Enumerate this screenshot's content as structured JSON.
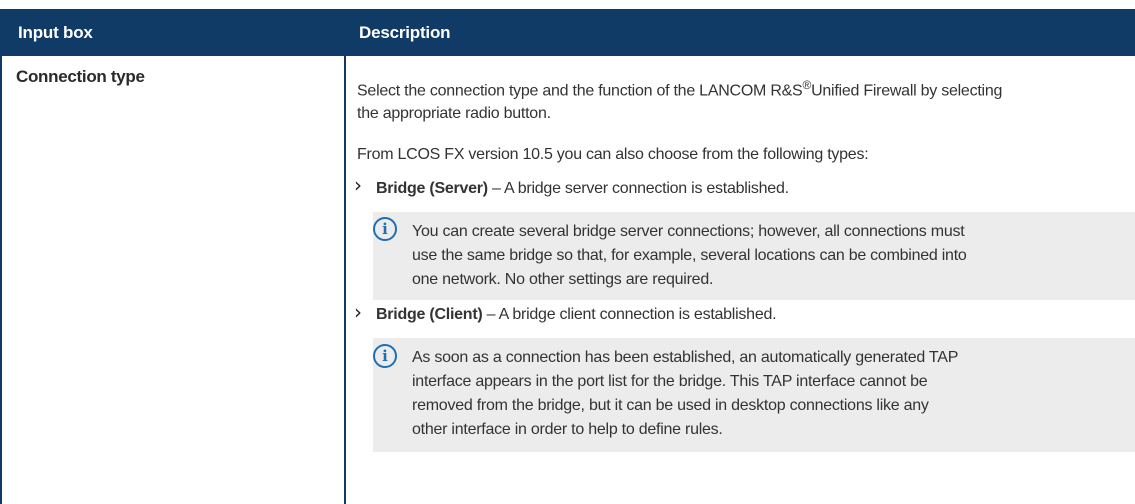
{
  "header": {
    "col1": "Input box",
    "col2": "Description"
  },
  "row": {
    "field": "Connection type",
    "intro_a": "Select the connection type and the function of the LANCOM R&S",
    "intro_reg": "®",
    "intro_b": "Unified Firewall by selecting",
    "intro_line2": "the appropriate radio button.",
    "version_note": "From LCOS FX version 10.5 you can also choose from the following types:",
    "items": [
      {
        "bullet": "›",
        "term": "Bridge (Server)",
        "desc": " – A bridge server connection is established.",
        "note_lines": [
          "You can create several bridge server connections; however, all connections must",
          "use the same bridge so that, for example, several locations can be combined into",
          "one network. No other settings are required."
        ]
      },
      {
        "bullet": "›",
        "term": "Bridge (Client)",
        "desc": " – A bridge client connection is established.",
        "note_lines": [
          "As soon as a connection has been established, an automatically generated TAP",
          "interface appears in the port list for the bridge. This TAP interface cannot be",
          "removed from the bridge, but it can be used in desktop connections like any",
          "other interface in order to help to define rules."
        ]
      }
    ],
    "info_icon_glyph": "i"
  },
  "colors": {
    "header_bg": "#0f3b66",
    "info_icon": "#1f6fb5",
    "note_bg": "#ececec"
  }
}
